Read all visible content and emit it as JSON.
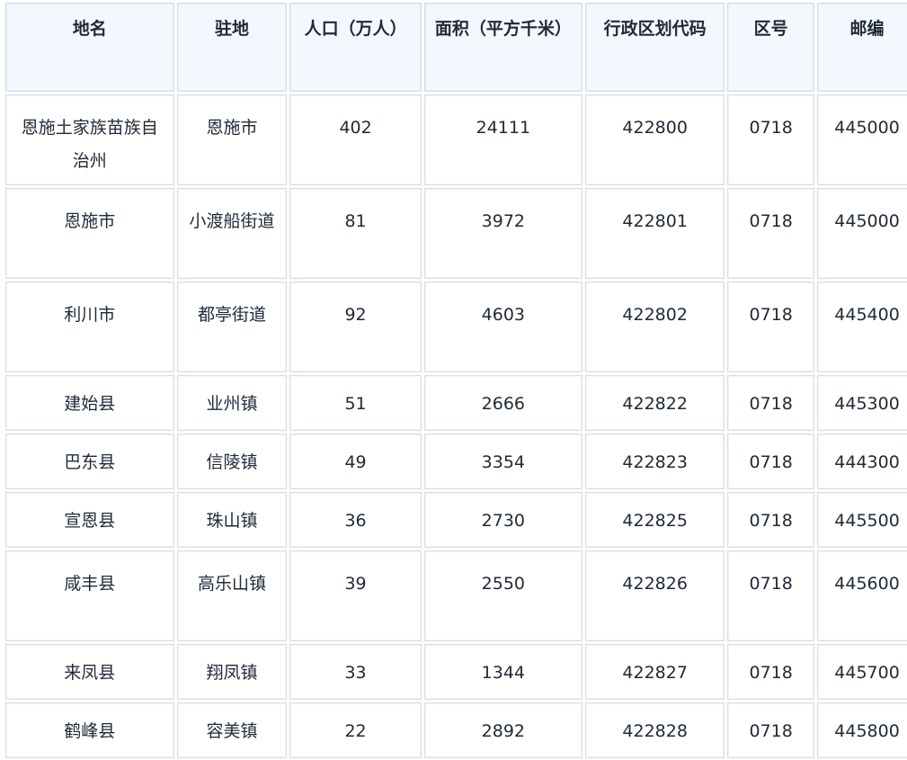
{
  "table": {
    "headers": [
      "地名",
      "驻地",
      "人口（万人）",
      "面积（平方千米）",
      "行政区划代码",
      "区号",
      "邮编"
    ],
    "rows": [
      [
        "恩施土家族苗族自治州",
        "恩施市",
        "402",
        "24111",
        "422800",
        "0718",
        "445000"
      ],
      [
        "恩施市",
        "小渡船街道",
        "81",
        "3972",
        "422801",
        "0718",
        "445000"
      ],
      [
        "利川市",
        "都亭街道",
        "92",
        "4603",
        "422802",
        "0718",
        "445400"
      ],
      [
        "建始县",
        "业州镇",
        "51",
        "2666",
        "422822",
        "0718",
        "445300"
      ],
      [
        "巴东县",
        "信陵镇",
        "49",
        "3354",
        "422823",
        "0718",
        "444300"
      ],
      [
        "宣恩县",
        "珠山镇",
        "36",
        "2730",
        "422825",
        "0718",
        "445500"
      ],
      [
        "咸丰县",
        "高乐山镇",
        "39",
        "2550",
        "422826",
        "0718",
        "445600"
      ],
      [
        "来凤县",
        "翔凤镇",
        "33",
        "1344",
        "422827",
        "0718",
        "445700"
      ],
      [
        "鹤峰县",
        "容美镇",
        "22",
        "2892",
        "422828",
        "0718",
        "445800"
      ]
    ]
  }
}
